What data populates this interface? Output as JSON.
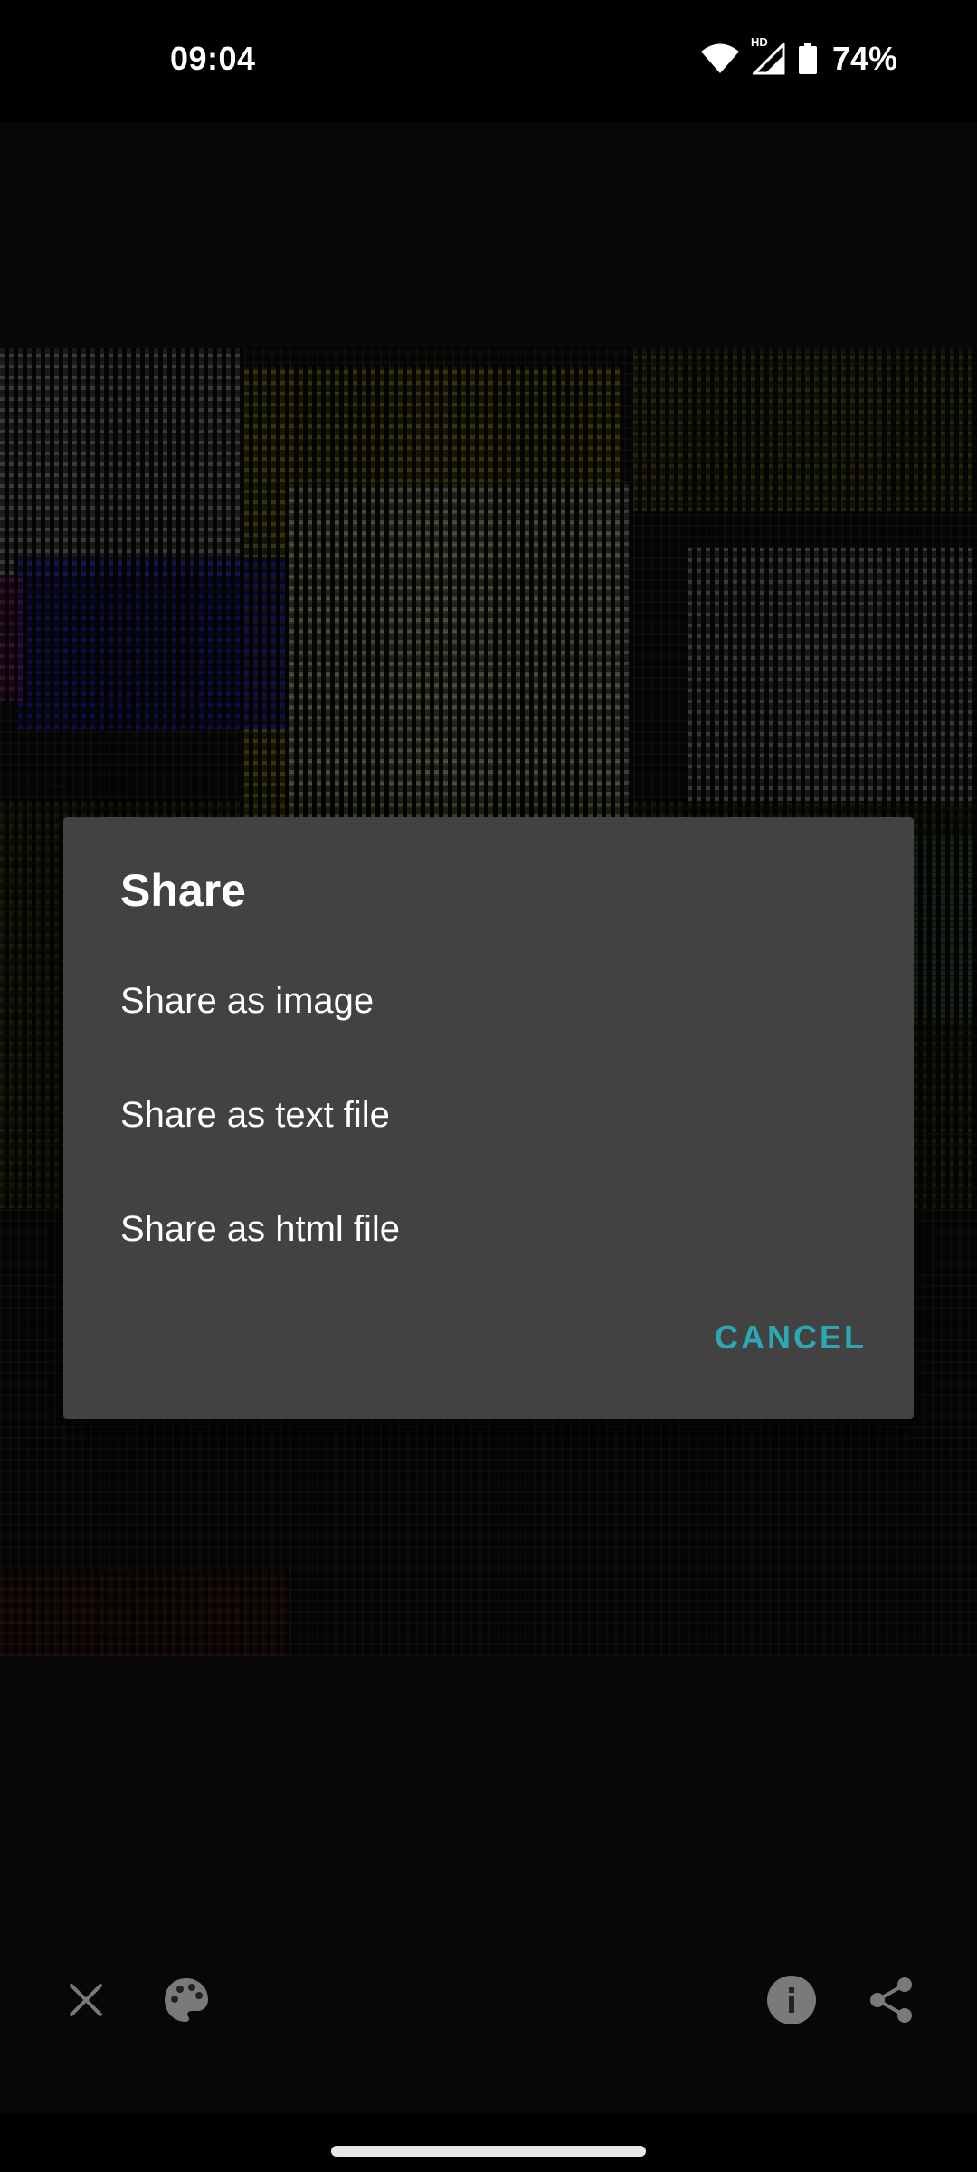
{
  "status_bar": {
    "time": "09:04",
    "network_badge": "HD",
    "battery": "74%"
  },
  "dialog": {
    "title": "Share",
    "options": [
      {
        "label": "Share as image"
      },
      {
        "label": "Share as text file"
      },
      {
        "label": "Share as html file"
      }
    ],
    "cancel_label": "CANCEL"
  },
  "toolbar": {
    "left_icons": [
      "close-icon",
      "palette-icon"
    ],
    "right_icons": [
      "info-icon",
      "share-icon"
    ]
  },
  "colors": {
    "dialog_bg": "#424242",
    "accent": "#2ca7b3",
    "app_bg": "#111111"
  }
}
